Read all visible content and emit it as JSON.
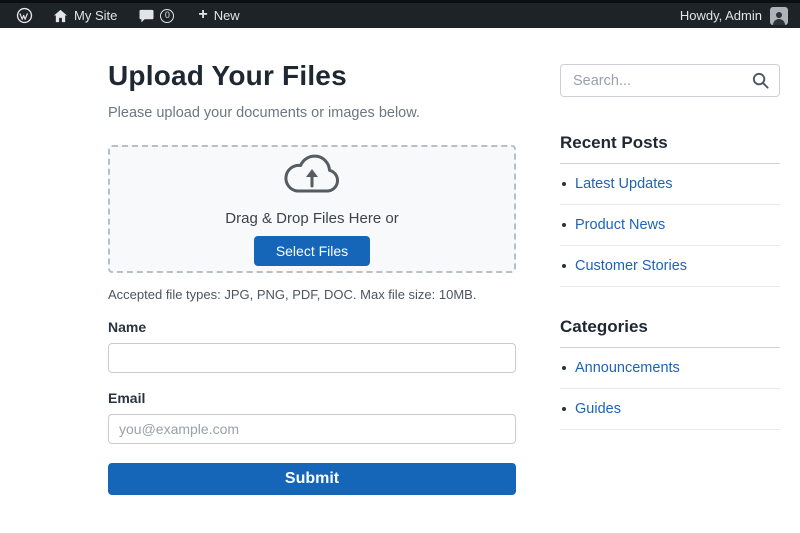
{
  "colors": {
    "admin_bar_bg": "#1d2327",
    "admin_text": "#e2e4e7",
    "accent": "#1566b8",
    "link": "#1d64b5",
    "heading": "#1f2733",
    "muted": "#6c7781",
    "dropzone_bg": "#f8f9fa",
    "dropzone_border": "#b9bfc6"
  },
  "admin_bar": {
    "site_label": "My Site",
    "comment_count": "0",
    "new_label": "New",
    "plus_glyph": "+",
    "howdy": "Howdy, Admin",
    "icons": {
      "wordpress_logo": "circle-w",
      "home": "house",
      "comments": "speech-bubble",
      "avatar": "person-silhouette"
    }
  },
  "main": {
    "title": "Upload Your Files",
    "subtitle": "Please upload your documents or images below.",
    "dropzone": {
      "icon": "cloud-arrow-up",
      "text": "Drag & Drop Files Here or",
      "button_label": "Select Files"
    },
    "file_note": "Accepted file types: JPG, PNG, PDF, DOC. Max file size: 10MB.",
    "form": {
      "name_label": "Name",
      "name_value": "",
      "email_label": "Email",
      "email_placeholder": "you@example.com",
      "email_value": "",
      "submit_label": "Submit"
    }
  },
  "sidebar": {
    "search": {
      "placeholder": "Search...",
      "icon": "magnifier"
    },
    "recent_posts": {
      "title": "Recent Posts",
      "items": [
        {
          "label": "Latest Updates"
        },
        {
          "label": "Product News"
        },
        {
          "label": "Customer Stories"
        }
      ]
    },
    "categories": {
      "title": "Categories",
      "items": [
        {
          "label": "Announcements"
        },
        {
          "label": "Guides"
        }
      ]
    }
  }
}
